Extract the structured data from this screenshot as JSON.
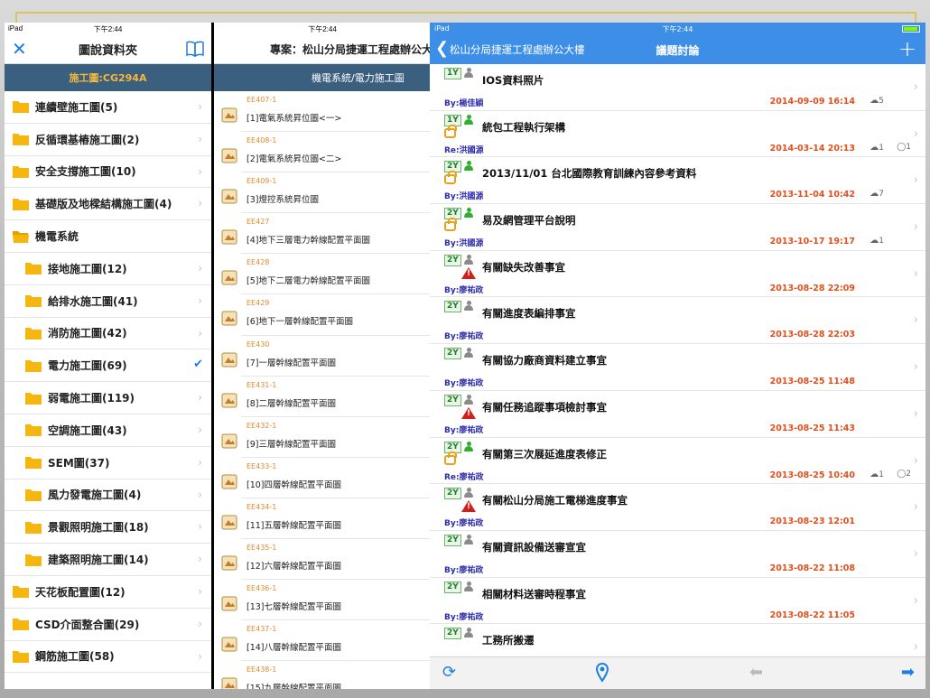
{
  "pane1": {
    "status_left": "iPad",
    "status_time": "下午2:44",
    "title": "圖說資料夾",
    "close_icon": "close-icon",
    "book_icon": "book-icon",
    "subheader": "施工圖:CG294A",
    "folders": [
      {
        "label": "連續壁施工圖(5)",
        "child": false,
        "selected": false
      },
      {
        "label": "反循環基樁施工圖(2)",
        "child": false,
        "selected": false
      },
      {
        "label": "安全支撐施工圖(10)",
        "child": false,
        "selected": false
      },
      {
        "label": "基礎版及地樑結構施工圖(4)",
        "child": false,
        "selected": false
      },
      {
        "label": "機電系統",
        "child": false,
        "selected": false,
        "open": true
      },
      {
        "label": "接地施工圖(12)",
        "child": true,
        "selected": false
      },
      {
        "label": "給排水施工圖(41)",
        "child": true,
        "selected": false
      },
      {
        "label": "消防施工圖(42)",
        "child": true,
        "selected": false
      },
      {
        "label": "電力施工圖(69)",
        "child": true,
        "selected": true
      },
      {
        "label": "弱電施工圖(119)",
        "child": true,
        "selected": false
      },
      {
        "label": "空調施工圖(43)",
        "child": true,
        "selected": false
      },
      {
        "label": "SEM圖(37)",
        "child": true,
        "selected": false
      },
      {
        "label": "風力發電施工圖(4)",
        "child": true,
        "selected": false
      },
      {
        "label": "景觀照明施工圖(18)",
        "child": true,
        "selected": false
      },
      {
        "label": "建築照明施工圖(14)",
        "child": true,
        "selected": false
      },
      {
        "label": "天花板配置圖(12)",
        "child": false,
        "selected": false
      },
      {
        "label": "CSD介面整合圖(29)",
        "child": false,
        "selected": false
      },
      {
        "label": "鋼筋施工圖(58)",
        "child": false,
        "selected": false
      }
    ]
  },
  "pane2": {
    "status_time": "下午2:44",
    "title": "專案：松山分局捷運工程處辦公大",
    "subheader": "機電系統/電力施工圖",
    "sheets": [
      {
        "code": "EE407-1",
        "name": "[1]電氣系統昇位圖<一>"
      },
      {
        "code": "EE408-1",
        "name": "[2]電氣系統昇位圖<二>"
      },
      {
        "code": "EE409-1",
        "name": "[3]燈控系統昇位圖"
      },
      {
        "code": "EE427",
        "name": "[4]地下三層電力幹線配置平面圖"
      },
      {
        "code": "EE428",
        "name": "[5]地下二層電力幹線配置平面圖"
      },
      {
        "code": "EE429",
        "name": "[6]地下一層幹線配置平面圖"
      },
      {
        "code": "EE430",
        "name": "[7]一層幹線配置平面圖"
      },
      {
        "code": "EE431-1",
        "name": "[8]二層幹線配置平面圖"
      },
      {
        "code": "EE432-1",
        "name": "[9]三層幹線配置平面圖"
      },
      {
        "code": "EE433-1",
        "name": "[10]四層幹線配置平面圖"
      },
      {
        "code": "EE434-1",
        "name": "[11]五層幹線配置平面圖"
      },
      {
        "code": "EE435-1",
        "name": "[12]六層幹線配置平面圖"
      },
      {
        "code": "EE436-1",
        "name": "[13]七層幹線配置平面圖"
      },
      {
        "code": "EE437-1",
        "name": "[14]八層幹線配置平面圖"
      },
      {
        "code": "EE438-1",
        "name": "[15]九層幹線配置平面圖"
      }
    ]
  },
  "pane3": {
    "status_left": "iPad",
    "status_time": "下午2:44",
    "back_label": "松山分局捷運工程處辦公大樓",
    "title": "議題討論",
    "add_icon": "plus-icon",
    "topics": [
      {
        "badge": "1Y",
        "person": "gray",
        "lock": false,
        "warn": false,
        "title": "IOS資料照片",
        "author": "By:楊佳穎",
        "date": "2014-09-09 16:14",
        "downloads": "5",
        "comments": ""
      },
      {
        "badge": "1Y",
        "person": "green",
        "lock": true,
        "warn": false,
        "title": "統包工程執行架構",
        "author": "Re:洪國源",
        "date": "2014-03-14 20:13",
        "downloads": "1",
        "comments": "1"
      },
      {
        "badge": "2Y",
        "person": "green",
        "lock": true,
        "warn": false,
        "title": "2013/11/01 台北國際教育訓練內容參考資料",
        "author": "By:洪國源",
        "date": "2013-11-04 10:42",
        "downloads": "7",
        "comments": ""
      },
      {
        "badge": "2Y",
        "person": "green",
        "lock": true,
        "warn": false,
        "title": "易及網管理平台說明",
        "author": "By:洪國源",
        "date": "2013-10-17 19:17",
        "downloads": "1",
        "comments": ""
      },
      {
        "badge": "2Y",
        "person": "gray",
        "lock": false,
        "warn": true,
        "title": "有關缺失改善事宜",
        "author": "By:廖祐政",
        "date": "2013-08-28 22:09",
        "downloads": "",
        "comments": ""
      },
      {
        "badge": "2Y",
        "person": "gray",
        "lock": false,
        "warn": false,
        "title": "有關進度表編排事宜",
        "author": "By:廖祐政",
        "date": "2013-08-28 22:03",
        "downloads": "",
        "comments": ""
      },
      {
        "badge": "2Y",
        "person": "gray",
        "lock": false,
        "warn": false,
        "title": "有關協力廠商資料建立事宜",
        "author": "By:廖祐政",
        "date": "2013-08-25 11:48",
        "downloads": "",
        "comments": ""
      },
      {
        "badge": "2Y",
        "person": "gray",
        "lock": false,
        "warn": true,
        "title": "有關任務追蹤事項檢討事宜",
        "author": "By:廖祐政",
        "date": "2013-08-25 11:43",
        "downloads": "",
        "comments": ""
      },
      {
        "badge": "2Y",
        "person": "green",
        "lock": true,
        "warn": false,
        "title": "有關第三次展延進度表修正",
        "author": "Re:廖祐政",
        "date": "2013-08-25 10:40",
        "downloads": "1",
        "comments": "2"
      },
      {
        "badge": "2Y",
        "person": "gray",
        "lock": false,
        "warn": true,
        "title": "有關松山分局施工電梯進度事宜",
        "author": "By:廖祐政",
        "date": "2013-08-23 12:01",
        "downloads": "",
        "comments": ""
      },
      {
        "badge": "2Y",
        "person": "gray",
        "lock": false,
        "warn": false,
        "title": "有關資訊設備送審宣宜",
        "author": "By:廖祐政",
        "date": "2013-08-22 11:08",
        "downloads": "",
        "comments": ""
      },
      {
        "badge": "2Y",
        "person": "gray",
        "lock": false,
        "warn": false,
        "title": "相關材料送審時程事宜",
        "author": "By:廖祐政",
        "date": "2013-08-22 11:05",
        "downloads": "",
        "comments": ""
      },
      {
        "badge": "2Y",
        "person": "gray",
        "lock": false,
        "warn": false,
        "title": "工務所搬遷",
        "author": "",
        "date": "",
        "downloads": "",
        "comments": ""
      }
    ],
    "toolbar": {
      "refresh_icon": "refresh-icon",
      "pin_icon": "location-pin-icon",
      "prev_icon": "arrow-left-icon",
      "next_icon": "arrow-right-icon"
    }
  },
  "colors": {
    "nav_blue": "#3d8ee6",
    "subheader": "#3b5f7e",
    "folder_yellow": "#f5b70f",
    "date_orange": "#e14f1c",
    "author_blue": "#2c2cae"
  }
}
